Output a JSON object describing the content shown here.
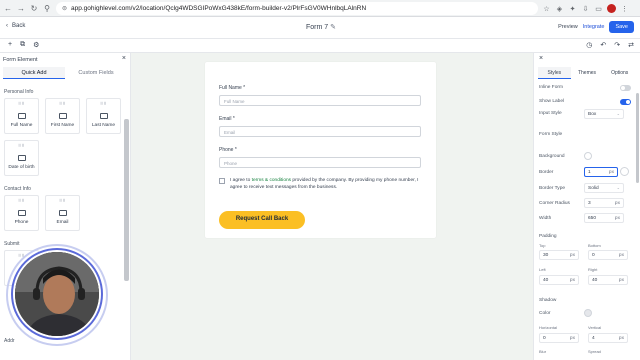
{
  "browser": {
    "url": "app.gohighlevel.com/v2/location/Qclg4WDSGIPoWxG438kE/form-builder-v2/PlrFsGV0WHnlbqLAlnRN"
  },
  "header": {
    "back_label": "Back",
    "form_title": "Form 7",
    "preview_label": "Preview",
    "integrate_label": "Integrate",
    "save_label": "Save"
  },
  "left_panel": {
    "title": "Form Element",
    "tabs": [
      "Quick Add",
      "Custom Fields"
    ],
    "sections": [
      {
        "label": "Personal Info",
        "items": [
          "Full Name",
          "First Name",
          "Last Name",
          "Date of birth"
        ]
      },
      {
        "label": "Contact Info",
        "items": [
          "Phone",
          "Email"
        ]
      },
      {
        "label": "Submit",
        "items": [
          ""
        ]
      },
      {
        "label": "Addr",
        "items": []
      }
    ]
  },
  "form": {
    "fields": [
      {
        "label": "Full Name *",
        "placeholder": "Full Name"
      },
      {
        "label": "Email *",
        "placeholder": "Email"
      },
      {
        "label": "Phone *",
        "placeholder": "Phone"
      }
    ],
    "consent_pre": "I agree to ",
    "consent_link": "terms & conditions",
    "consent_post": " provided by the company. By providing my phone number, I agree to receive text messages from the business.",
    "button_label": "Request Call Back"
  },
  "right_panel": {
    "tabs": [
      "Styles",
      "Themes",
      "Options"
    ],
    "inline_form_label": "Inline Form",
    "inline_form_on": false,
    "show_label_label": "Show Label",
    "show_label_on": true,
    "input_style_label": "Input Style",
    "input_style_value": "Box",
    "form_style_heading": "Form Style",
    "background_label": "Background",
    "border_label": "Border",
    "border_value": "1",
    "border_type_label": "Border Type",
    "border_type_value": "Solid",
    "corner_radius_label": "Corner Radius",
    "corner_radius_value": "3",
    "width_label": "Width",
    "width_value": "650",
    "unit": "px",
    "padding_heading": "Padding",
    "padding": [
      {
        "label": "Top",
        "value": "30"
      },
      {
        "label": "Bottom",
        "value": "0"
      },
      {
        "label": "Left",
        "value": "40"
      },
      {
        "label": "Right",
        "value": "40"
      }
    ],
    "shadow_heading": "Shadow",
    "shadow_color_label": "Color",
    "shadow": [
      {
        "label": "Horizontal",
        "value": "0"
      },
      {
        "label": "Vertical",
        "value": "4"
      },
      {
        "label": "Blur",
        "value": ""
      },
      {
        "label": "Spread",
        "value": ""
      }
    ]
  },
  "colors": {
    "accent": "#2563eb",
    "cta": "#fbbf24",
    "canvas_bg": "#f0f3f0"
  }
}
